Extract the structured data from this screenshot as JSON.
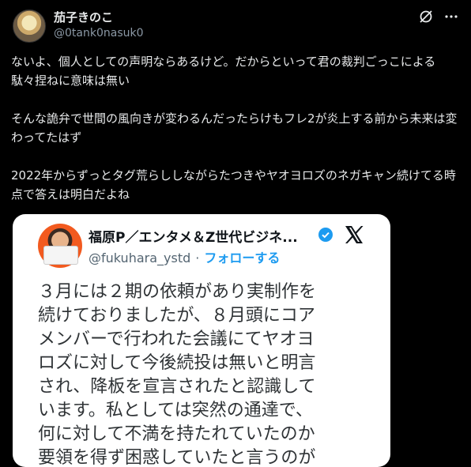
{
  "author": {
    "display_name": "茄子きのこ",
    "handle": "@0tank0nasuk0"
  },
  "header_icons": [
    "grok-icon",
    "more-icon"
  ],
  "tweet": {
    "paragraph1": "ないよ、個人としての声明ならあるけど。だからといって君の裁判ごっこによる駄々捏ねに意味は無い",
    "paragraph2": "そんな詭弁で世間の風向きが変わるんだったらけもフレ2が炎上する前から未来は変わってたはず",
    "paragraph3": "2022年からずっとタグ荒らししながらたつきやヤオヨロズのネガキャン続けてる時点で答えは明白だよね"
  },
  "quoted": {
    "name": "福原P／エンタメ＆Z世代ビジネ...",
    "handle": "@fukuhara_ystd",
    "separator": "·",
    "follow_label": "フォローする",
    "body": "３月には２期の依頼があり実制作を\n続けておりましたが、８月頭にコア\nメンバーで行われた会議にてヤオヨ\nロズに対して今後続投は無いと明言\nされ、降板を宣言されたと認識して\nいます。私としては突然の通達で、\n何に対して不満を持たれていたのか\n要領を得ず困惑していたと言うのが"
  },
  "colors": {
    "background": "#000000",
    "text": "#e7e9ea",
    "muted": "#8b98a5",
    "link": "#1d9bf0",
    "verified": "#1d9bf0"
  }
}
